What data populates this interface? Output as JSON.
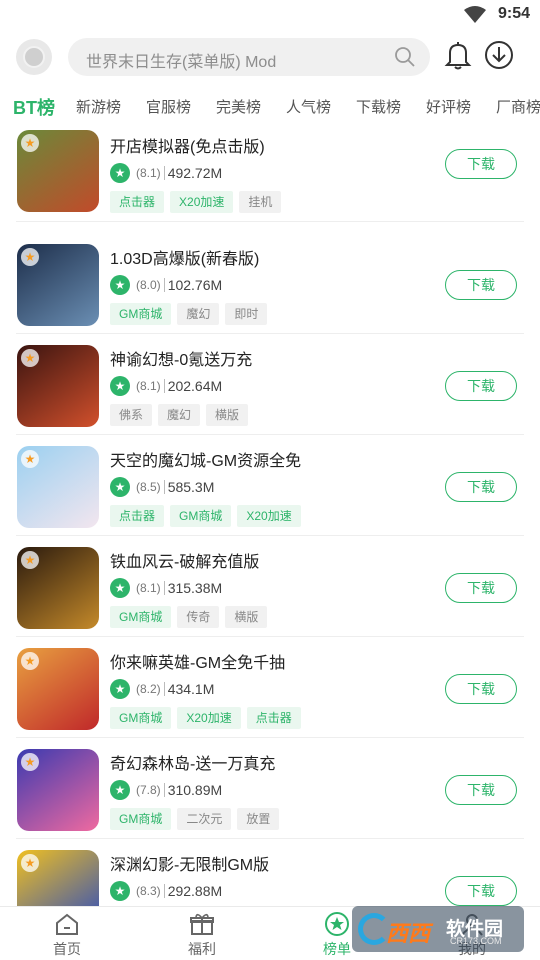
{
  "status_bar": {
    "time": "9:54"
  },
  "search": {
    "placeholder": "世界末日生存(菜单版) Mod"
  },
  "tabs": [
    "BT榜",
    "新游榜",
    "官服榜",
    "完美榜",
    "人气榜",
    "下载榜",
    "好评榜",
    "厂商榜"
  ],
  "active_tab_index": 0,
  "download_label": "下载",
  "games": [
    {
      "title": "开店模拟器(免点击版)",
      "score": "(8.1)",
      "size": "492.72M",
      "tags": [
        {
          "text": "点击器",
          "style": "green"
        },
        {
          "text": "X20加速",
          "style": "green"
        },
        {
          "text": "挂机",
          "style": "gray"
        }
      ],
      "thumb_colors": [
        "#6a8a3a",
        "#c24a2a"
      ]
    },
    {
      "title": "1.03D高爆版(新春版)",
      "score": "(8.0)",
      "size": "102.76M",
      "tags": [
        {
          "text": "GM商城",
          "style": "green"
        },
        {
          "text": "魔幻",
          "style": "gray"
        },
        {
          "text": "即时",
          "style": "gray"
        }
      ],
      "thumb_colors": [
        "#1d2e4a",
        "#6b8fb4"
      ]
    },
    {
      "title": "神谕幻想-0氪送万充",
      "score": "(8.1)",
      "size": "202.64M",
      "tags": [
        {
          "text": "佛系",
          "style": "gray"
        },
        {
          "text": "魔幻",
          "style": "gray"
        },
        {
          "text": "横版",
          "style": "gray"
        }
      ],
      "thumb_colors": [
        "#3a1410",
        "#d2502c"
      ]
    },
    {
      "title": "天空的魔幻城-GM资源全免",
      "score": "(8.5)",
      "size": "585.3M",
      "tags": [
        {
          "text": "点击器",
          "style": "green"
        },
        {
          "text": "GM商城",
          "style": "green"
        },
        {
          "text": "X20加速",
          "style": "green"
        }
      ],
      "thumb_colors": [
        "#9bd0f0",
        "#f3e6ef"
      ]
    },
    {
      "title": "铁血风云-破解充值版",
      "score": "(8.1)",
      "size": "315.38M",
      "tags": [
        {
          "text": "GM商城",
          "style": "green"
        },
        {
          "text": "传奇",
          "style": "gray"
        },
        {
          "text": "横版",
          "style": "gray"
        }
      ],
      "thumb_colors": [
        "#2a1a0e",
        "#c58a2a"
      ]
    },
    {
      "title": "你来嘛英雄-GM全免千抽",
      "score": "(8.2)",
      "size": "434.1M",
      "tags": [
        {
          "text": "GM商城",
          "style": "green"
        },
        {
          "text": "X20加速",
          "style": "green"
        },
        {
          "text": "点击器",
          "style": "green"
        }
      ],
      "thumb_colors": [
        "#e8a040",
        "#c0282a"
      ]
    },
    {
      "title": "奇幻森林岛-送一万真充",
      "score": "(7.8)",
      "size": "310.89M",
      "tags": [
        {
          "text": "GM商城",
          "style": "green"
        },
        {
          "text": "二次元",
          "style": "gray"
        },
        {
          "text": "放置",
          "style": "gray"
        }
      ],
      "thumb_colors": [
        "#3a3ab0",
        "#f06aa0"
      ]
    },
    {
      "title": "深渊幻影-无限制GM版",
      "score": "(8.3)",
      "size": "292.88M",
      "tags": [],
      "thumb_colors": [
        "#f0c020",
        "#2a4ac0"
      ]
    }
  ],
  "bottom_nav": [
    {
      "label": "首页",
      "icon": "home-icon"
    },
    {
      "label": "福利",
      "icon": "gift-icon"
    },
    {
      "label": "榜单",
      "icon": "ranking-icon"
    },
    {
      "label": "我的",
      "icon": "profile-icon"
    }
  ],
  "active_nav_index": 2,
  "watermark": {
    "brand": "西西",
    "name": "软件园",
    "url": "CR173.COM"
  },
  "colors": {
    "accent": "#2db46a",
    "tag_green_bg": "#eaf7ef",
    "tag_gray_bg": "#f1f1f1"
  }
}
